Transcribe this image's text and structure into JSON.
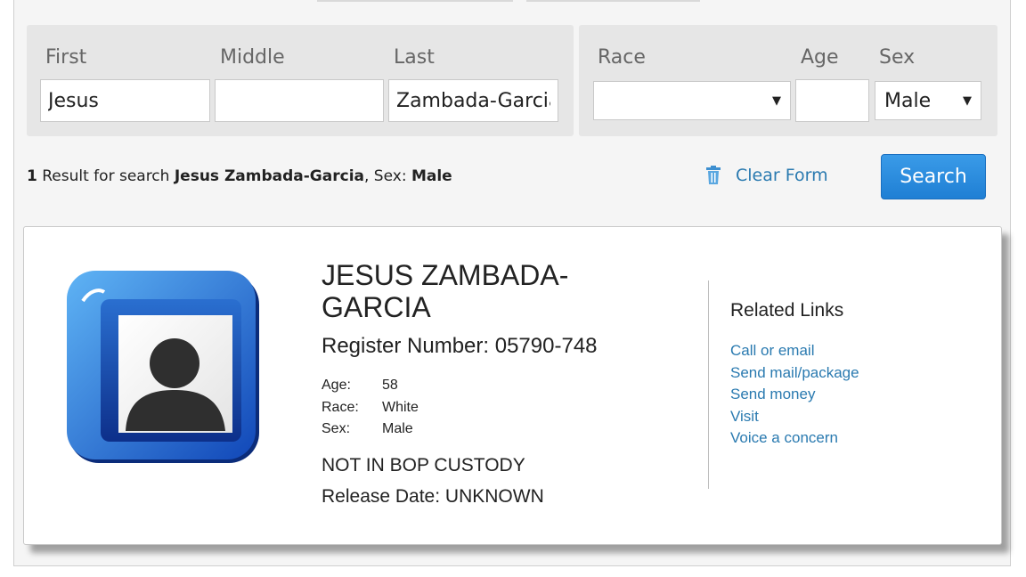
{
  "search_form": {
    "first": {
      "label": "First",
      "value": "Jesus"
    },
    "middle": {
      "label": "Middle",
      "value": ""
    },
    "last": {
      "label": "Last",
      "value": "Zambada-Garcia"
    },
    "race": {
      "label": "Race",
      "selected": ""
    },
    "age": {
      "label": "Age",
      "value": ""
    },
    "sex": {
      "label": "Sex",
      "selected": "Male"
    }
  },
  "result_summary": {
    "count": "1",
    "prefix": " Result for search ",
    "query": "Jesus Zambada-Garcia",
    "sex_prefix": ", Sex: ",
    "sex": "Male"
  },
  "actions": {
    "clear_label": "Clear Form",
    "search_label": "Search"
  },
  "inmate": {
    "name": "JESUS ZAMBADA-GARCIA",
    "register_label": "Register Number:",
    "register_number": "05790-748",
    "age_label": "Age:",
    "age": "58",
    "race_label": "Race:",
    "race": "White",
    "sex_label": "Sex:",
    "sex": "Male",
    "status": "NOT IN BOP CUSTODY",
    "release_label": "Release Date:",
    "release_date": "UNKNOWN"
  },
  "related": {
    "title": "Related Links",
    "links": [
      "Call or email",
      "Send mail/package",
      "Send money",
      "Visit",
      "Voice a concern"
    ]
  },
  "colors": {
    "accent_link": "#2a7ab0",
    "button": "#2686dc",
    "panel": "#e6e6e6"
  }
}
